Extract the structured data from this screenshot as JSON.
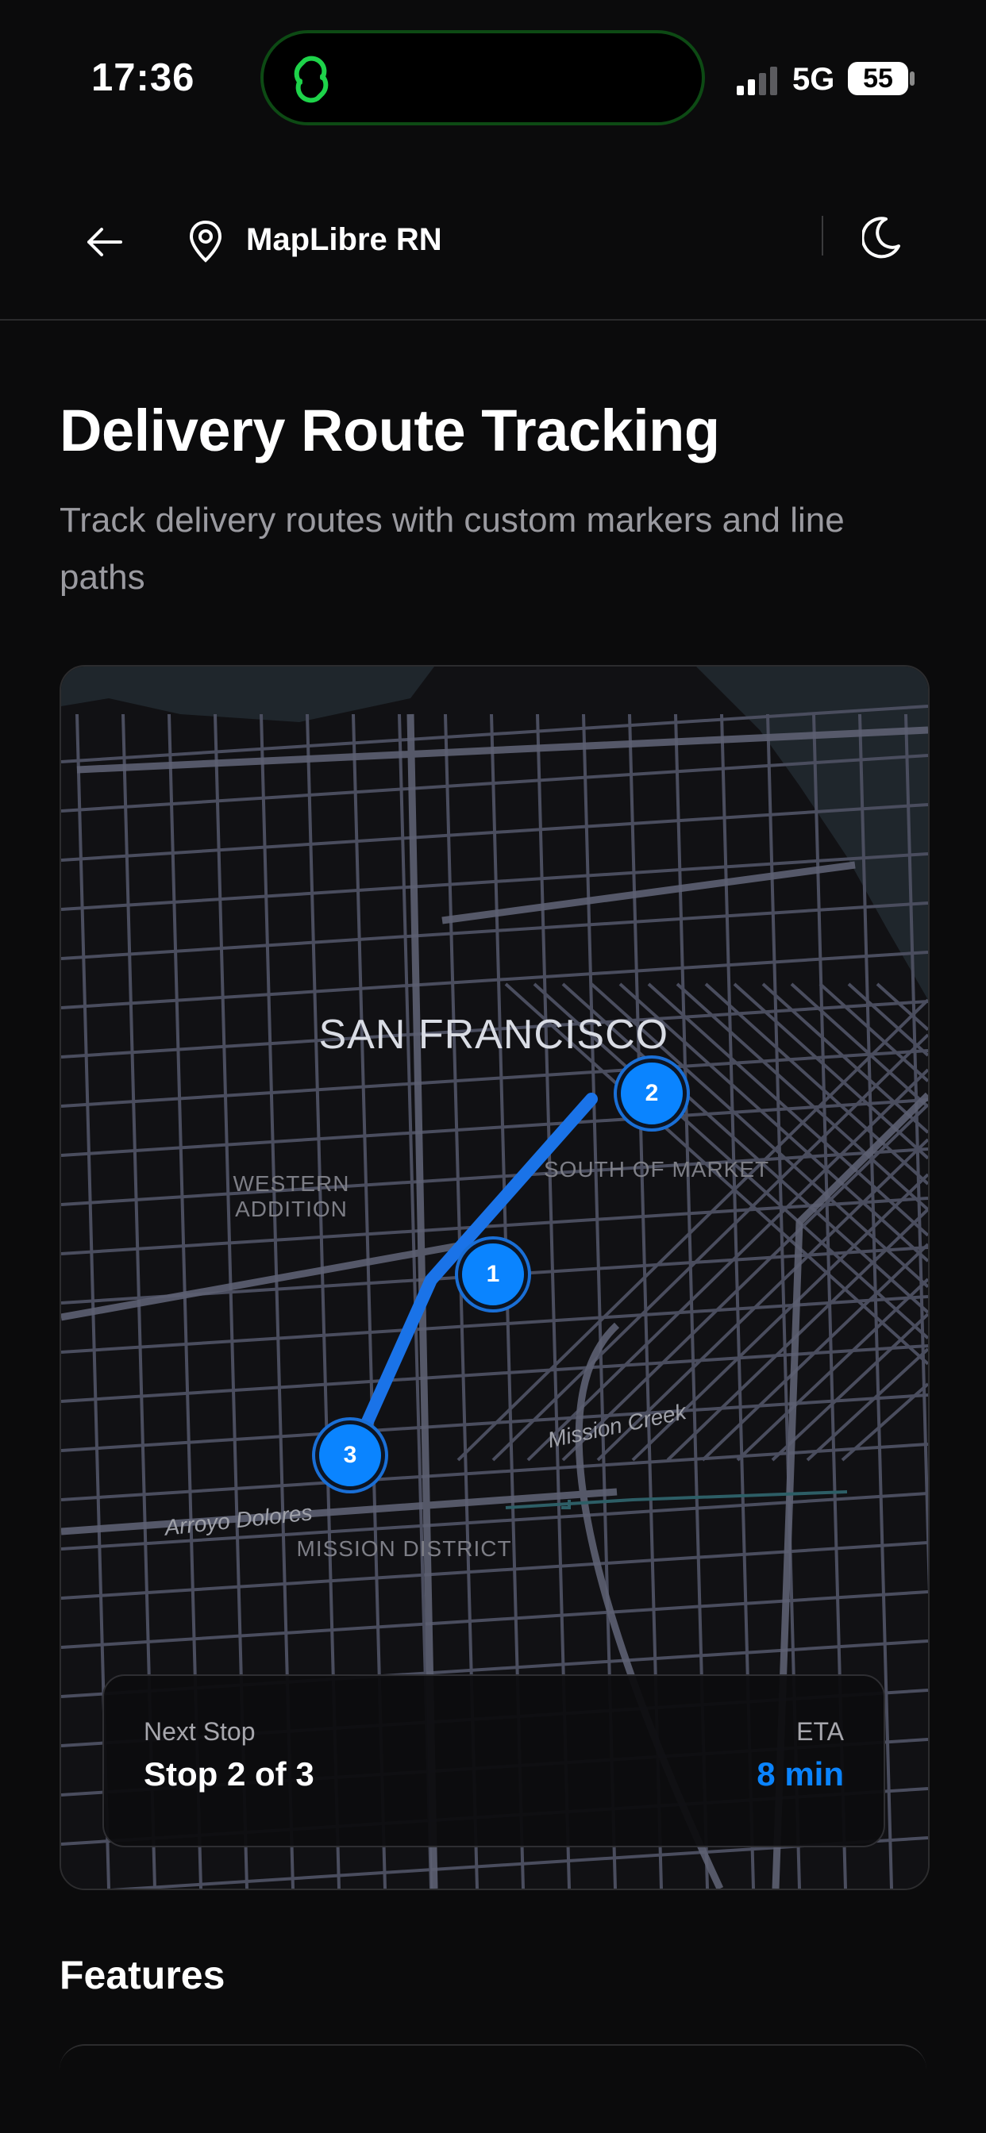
{
  "status_bar": {
    "time": "17:36",
    "network": "5G",
    "battery": "55"
  },
  "header": {
    "app_title": "MapLibre RN"
  },
  "page": {
    "title": "Delivery Route Tracking",
    "subtitle": "Track delivery routes with custom markers and line paths"
  },
  "map": {
    "labels": {
      "city": "SAN FRANCISCO",
      "western_addition": "WESTERN\nADDITION",
      "south_of_market": "SOUTH OF MARKET",
      "mission_district": "MISSION DISTRICT",
      "mission_creek": "Mission Creek",
      "arroyo_dolores": "Arroyo Dolores"
    },
    "markers": [
      "1",
      "2",
      "3"
    ],
    "colors": {
      "route": "#1a73e8",
      "marker": "#0a84ff",
      "road": "#4a4d5e",
      "water": "#1f262c"
    }
  },
  "route_panel": {
    "next_stop_label": "Next Stop",
    "next_stop_value": "Stop 2 of 3",
    "eta_label": "ETA",
    "eta_value": "8 min",
    "eta_color": "#0a84ff"
  },
  "sections": {
    "features_heading": "Features"
  },
  "icons": [
    "app-link-icon",
    "signal-icon",
    "battery-icon",
    "back-arrow-icon",
    "location-pin-icon",
    "moon-icon"
  ]
}
